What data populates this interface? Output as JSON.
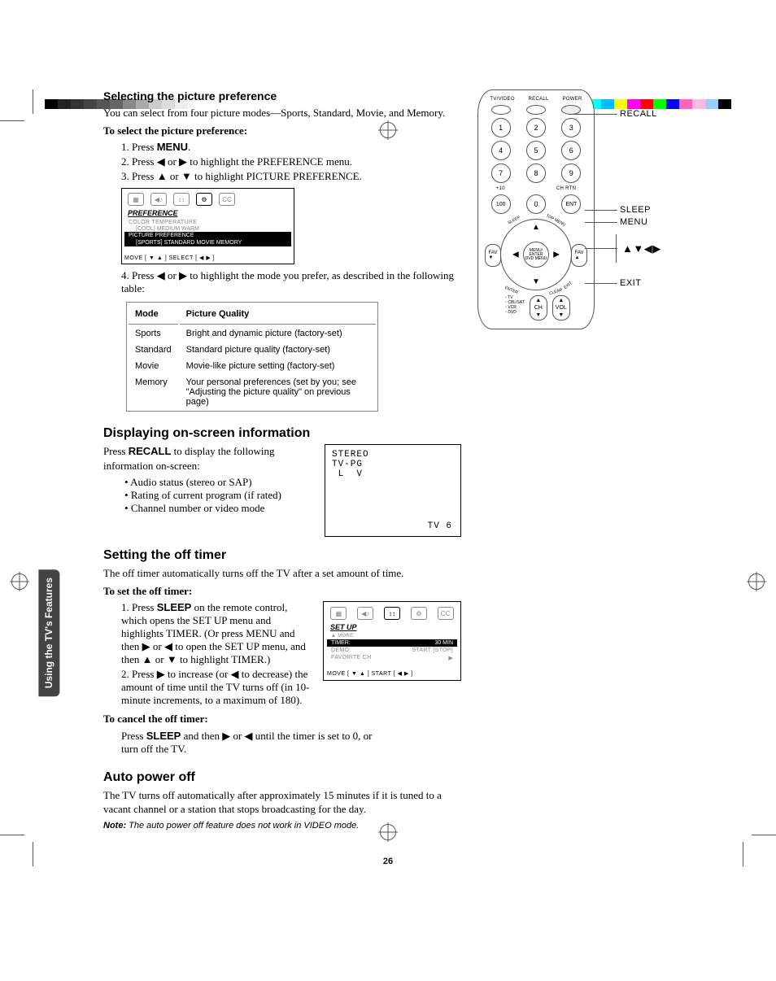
{
  "side_tab": "Using the TV's\nFeatures",
  "sec1": {
    "h": "Selecting the picture preference",
    "p1": "You can select from four picture modes—Sports, Standard, Movie, and Memory.",
    "sub": "To select the picture preference:",
    "s1a": "1.  Press ",
    "s1b": "MENU",
    "s1c": ".",
    "s2": "2.  Press ◀ or ▶ to highlight the PREFERENCE menu.",
    "s3": "3.  Press ▲ or ▼ to highlight PICTURE PREFERENCE.",
    "s4": "4.  Press ◀ or ▶ to highlight the mode you prefer, as described in the following table:"
  },
  "osd1": {
    "title": "PREFERENCE",
    "l1": "COLOR TEMPERATURE",
    "l1s": "[COOL]  MEDIUM  WARM",
    "l2": "PICTURE PREFERENCE",
    "l2s": "[SPORTS]  STANDARD   MOVIE   MEMORY",
    "foot": "MOVE [ ▼ ▲ ]     SELECT  [ ◀  ▶ ]"
  },
  "table": {
    "h1": "Mode",
    "h2": "Picture Quality",
    "r1a": "Sports",
    "r1b": "Bright and dynamic picture (factory-set)",
    "r2a": "Standard",
    "r2b": "Standard picture quality (factory-set)",
    "r3a": "Movie",
    "r3b": "Movie-like picture setting  (factory-set)",
    "r4a": "Memory",
    "r4b": "Your personal preferences (set by you; see \"Adjusting the picture quality\" on previous page)"
  },
  "sec2": {
    "h": "Displaying on-screen information",
    "p1a": "Press ",
    "p1b": "RECALL",
    "p1c": " to display the following information on-screen:",
    "b1": "Audio status (stereo or SAP)",
    "b2": "Rating of current program (if rated)",
    "b3": "Channel number or video mode"
  },
  "recall": {
    "l1": "STEREO",
    "l2": "TV-PG",
    "l3": " L  V",
    "br": "TV 6"
  },
  "sec3": {
    "h": "Setting the off timer",
    "p1": "The off timer automatically turns off the TV after a set amount of time.",
    "sub1": "To set the off timer:",
    "s1a": "1.  Press ",
    "s1b": "SLEEP",
    "s1c": " on the remote control, which opens the SET UP menu and highlights TIMER. (Or press MENU and then ▶ or ◀ to open the SET UP menu, and then ▲ or ▼ to highlight TIMER.)",
    "s2": "2.  Press ▶ to increase (or ◀ to decrease) the amount of time until the TV turns off (in 10-minute increments, to a maximum of 180).",
    "sub2": "To cancel the off timer:",
    "c1a": "Press ",
    "c1b": "SLEEP",
    "c1c": " and then ▶ or ◀ until the timer is set to 0, or turn off the TV."
  },
  "osd2": {
    "title": "SET UP",
    "more": "▲ MORE",
    "l1a": "TIMER:",
    "l1b": "30 MIN",
    "l2a": "DEMO:",
    "l2b": "START  [STOP]",
    "l3a": "FAVORITE CH",
    "l3b": "▶",
    "foot": "MOVE [ ▼ ▲ ]     START [ ◀  ▶ ]"
  },
  "sec4": {
    "h": "Auto power off",
    "p1": "The TV turns off automatically after approximately 15 minutes if it is tuned to a vacant channel or a station that stops broadcasting for the day.",
    "noteb": "Note:",
    "note": " The auto power off feature does not work in VIDEO mode."
  },
  "remote": {
    "top_lbls": "TV/VIDEO    RECALL    POWER",
    "n1": "1",
    "n2": "2",
    "n3": "3",
    "n4": "4",
    "n5": "5",
    "n6": "6",
    "n7": "7",
    "n8": "8",
    "n9": "9",
    "n100": "100",
    "n0": "0",
    "ent": "ENT",
    "lbl_10": "+10",
    "lbl_rtn": "CH RTN",
    "sleep": "SLEEP",
    "top": "TOP MENU",
    "center": "MENU/\nENTER\nDVD MENU",
    "fav_l": "FAV\n▼",
    "fav_r": "FAV\n▲",
    "enter": "ENTER",
    "exit": "EXIT",
    "clear": "CLEAR",
    "ch": "CH",
    "vol": "VOL",
    "modes": "▫ TV\n▫ CBL/SAT\n▫ VCR\n▫ DVD",
    "c_recall": "RECALL",
    "c_sleep": "SLEEP",
    "c_menu": "MENU",
    "c_arrows": "▲▼◀▶",
    "c_exit": "EXIT"
  },
  "page_num": "26"
}
